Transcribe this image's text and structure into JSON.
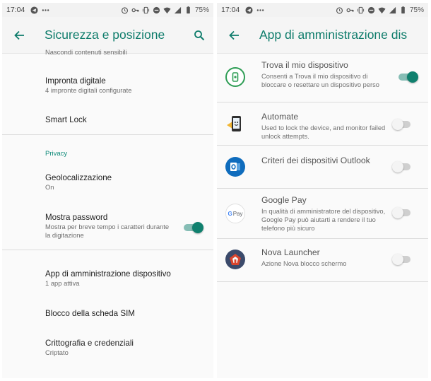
{
  "status_bar": {
    "time": "17:04",
    "battery": "75%",
    "left_icons": [
      "telegram-icon",
      "more-dots-icon"
    ],
    "right_icons": [
      "alarm-icon",
      "key-icon",
      "vibrate-icon",
      "do-not-disturb-icon",
      "wifi-icon",
      "signal-icon",
      "battery-icon"
    ]
  },
  "left_screen": {
    "title": "Sicurezza e posizione",
    "partial_top_text": "Nascondi contenuti sensibili",
    "items": [
      {
        "title": "Impronta digitale",
        "subtitle": "4 impronte digitali configurate"
      },
      {
        "title": "Smart Lock"
      }
    ],
    "privacy_header": "Privacy",
    "privacy_items": [
      {
        "title": "Geolocalizzazione",
        "subtitle": "On"
      },
      {
        "title": "Mostra password",
        "subtitle": "Mostra per breve tempo i caratteri durante la digitazione",
        "toggle": "on"
      }
    ],
    "bottom_items": [
      {
        "title": "App di amministrazione dispositivo",
        "subtitle": "1 app attiva"
      },
      {
        "title": "Blocco della scheda SIM"
      },
      {
        "title": "Crittografia e credenziali",
        "subtitle": "Criptato"
      }
    ]
  },
  "right_screen": {
    "title": "App di amministrazione dis",
    "apps": [
      {
        "name": "Trova il mio dispositivo",
        "description": "Consenti a Trova il mio dispositivo di bloccare o resettare un dispositivo perso",
        "enabled": true,
        "icon": "find-my-device-icon"
      },
      {
        "name": "Automate",
        "description": "Used to lock the device, and monitor failed unlock attempts.",
        "enabled": false,
        "icon": "automate-icon"
      },
      {
        "name": "Criteri dei dispositivi Outlook",
        "description": "",
        "enabled": false,
        "icon": "outlook-icon"
      },
      {
        "name": "Google Pay",
        "description": "In qualità di amministratore del dispositivo, Google Pay può aiutarti a rendere il tuo telefono più sicuro",
        "enabled": false,
        "icon": "google-pay-icon",
        "icon_text": "G Pay"
      },
      {
        "name": "Nova Launcher",
        "description": "Azione Nova blocco schermo",
        "enabled": false,
        "icon": "nova-launcher-icon"
      }
    ]
  },
  "colors": {
    "accent": "#0e7c6b",
    "toggle_on_thumb": "#10806e",
    "toggle_on_track": "#86bdb5",
    "toggle_off_thumb": "#f4f4f4",
    "toggle_off_track": "#cfcfcf",
    "background": "#fafafa"
  }
}
